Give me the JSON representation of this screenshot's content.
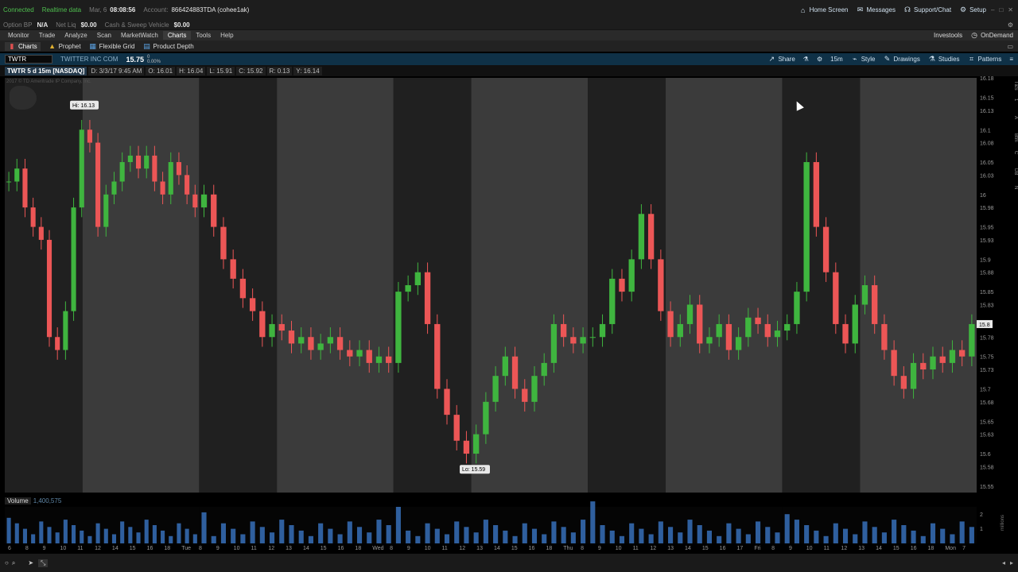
{
  "status": {
    "connected": "Connected",
    "realtime": "Realtime data",
    "date": "Mar, 6",
    "time": "08:08:56",
    "account_label": "Account:",
    "account": "866424883TDA (cohee1ak)",
    "links": [
      "Home Screen",
      "Messages",
      "Support/Chat",
      "Setup"
    ]
  },
  "account_bar": {
    "option_bp_label": "Option BP",
    "option_bp": "N/A",
    "net_liq_label": "Net Liq",
    "net_liq": "$0.00",
    "cash_label": "Cash & Sweep Vehicle",
    "cash": "$0.00"
  },
  "menu": {
    "items": [
      "Monitor",
      "Trade",
      "Analyze",
      "Scan",
      "MarketWatch",
      "Charts",
      "Tools",
      "Help"
    ],
    "active": "Charts",
    "right": [
      "Investools",
      "OnDemand"
    ]
  },
  "subtabs": [
    "Charts",
    "Prophet",
    "Flexible Grid",
    "Product Depth"
  ],
  "symbol_bar": {
    "symbol": "TWTR",
    "company": "TWITTER INC COM",
    "last": "15.75",
    "change": "0",
    "change_pct": "0.00%",
    "tools": [
      "Share",
      "15m",
      "Style",
      "Drawings",
      "Studies",
      "Patterns"
    ]
  },
  "info_bar": {
    "title": "TWTR 5 d 15m [NASDAQ]",
    "date": "D: 3/3/17 9:45 AM",
    "open": "O: 16.01",
    "high": "H: 16.04",
    "low": "L: 15.91",
    "close": "C: 15.92",
    "range": "R: 0.13",
    "y": "Y: 16.14"
  },
  "watermark": "2017 © TD Ameritrade IP Company, Inc.",
  "right_tabs": [
    "T&S",
    "1",
    "A",
    "Btm",
    "C",
    "DB",
    "N"
  ],
  "colors": {
    "up": "#3fb53f",
    "down": "#ec5656",
    "volume": "#2f5f9e",
    "band_light": "#3b3b3b",
    "band_dark": "#202020"
  },
  "chart_data": {
    "type": "bar",
    "title": "TWTR 5 d 15m [NASDAQ]",
    "price_axis": {
      "min": 15.54,
      "max": 16.18,
      "ticks": [
        "16.18",
        "16.15",
        "16.13",
        "16.1",
        "16.08",
        "16.05",
        "16.03",
        "16",
        "15.98",
        "15.95",
        "15.93",
        "15.9",
        "15.88",
        "15.85",
        "15.83",
        "15.8",
        "15.78",
        "15.75",
        "15.73",
        "15.7",
        "15.68",
        "15.65",
        "15.63",
        "15.6",
        "15.58",
        "15.55"
      ]
    },
    "last_price_label": "15.8",
    "hi_label": "Hi: 16.13",
    "lo_label": "Lo: 15.59",
    "volume_label": "Volume",
    "volume_value": "1,400,575",
    "volume_unit": "millions",
    "volume_ticks": [
      "2",
      "1"
    ],
    "x_labels": [
      "6",
      "8",
      "9",
      "10",
      "11",
      "12",
      "14",
      "15",
      "16",
      "18",
      "Tue",
      "8",
      "9",
      "10",
      "11",
      "12",
      "13",
      "14",
      "15",
      "16",
      "18",
      "Wed",
      "8",
      "9",
      "10",
      "11",
      "12",
      "13",
      "14",
      "15",
      "16",
      "18",
      "Thu",
      "8",
      "9",
      "10",
      "11",
      "12",
      "13",
      "14",
      "15",
      "16",
      "17",
      "Fri",
      "8",
      "9",
      "10",
      "11",
      "12",
      "13",
      "14",
      "15",
      "16",
      "18",
      "Mon",
      "7"
    ],
    "sessions": [
      {
        "day": "Tue",
        "closes": [
          16.02,
          16.04,
          15.98,
          15.95,
          15.93,
          15.78,
          15.76,
          15.82,
          15.98,
          16.1,
          16.08,
          15.95,
          16.0,
          16.02,
          16.05,
          16.06,
          16.04,
          16.06,
          16.02,
          16.0,
          16.05,
          16.03,
          16.0,
          15.98
        ]
      },
      {
        "day": "Wed",
        "closes": [
          16.0,
          15.95,
          15.9,
          15.87,
          15.84,
          15.82,
          15.78,
          15.8,
          15.79,
          15.77,
          15.78,
          15.76,
          15.77,
          15.78,
          15.76,
          15.75,
          15.76,
          15.74,
          15.75,
          15.74
        ]
      },
      {
        "day": "Thu",
        "closes": [
          15.85,
          15.86,
          15.88,
          15.8,
          15.7,
          15.66,
          15.62,
          15.6,
          15.63,
          15.68,
          15.72,
          15.75,
          15.7,
          15.68,
          15.72,
          15.74,
          15.8,
          15.78,
          15.77,
          15.78
        ]
      },
      {
        "day": "Fri",
        "closes": [
          15.78,
          15.8,
          15.87,
          15.85,
          15.9,
          15.97,
          15.9,
          15.82,
          15.78,
          15.8,
          15.83,
          15.77,
          15.78,
          15.8,
          15.76,
          15.78,
          15.81,
          15.8,
          15.78,
          15.79
        ]
      },
      {
        "day": "Mon",
        "closes": [
          15.8,
          15.85,
          16.05,
          15.95,
          15.88,
          15.8,
          15.77,
          15.83,
          15.86,
          15.8,
          15.76,
          15.72,
          15.7,
          15.74,
          15.73,
          15.75,
          15.74,
          15.76,
          15.75,
          15.8
        ]
      }
    ]
  }
}
